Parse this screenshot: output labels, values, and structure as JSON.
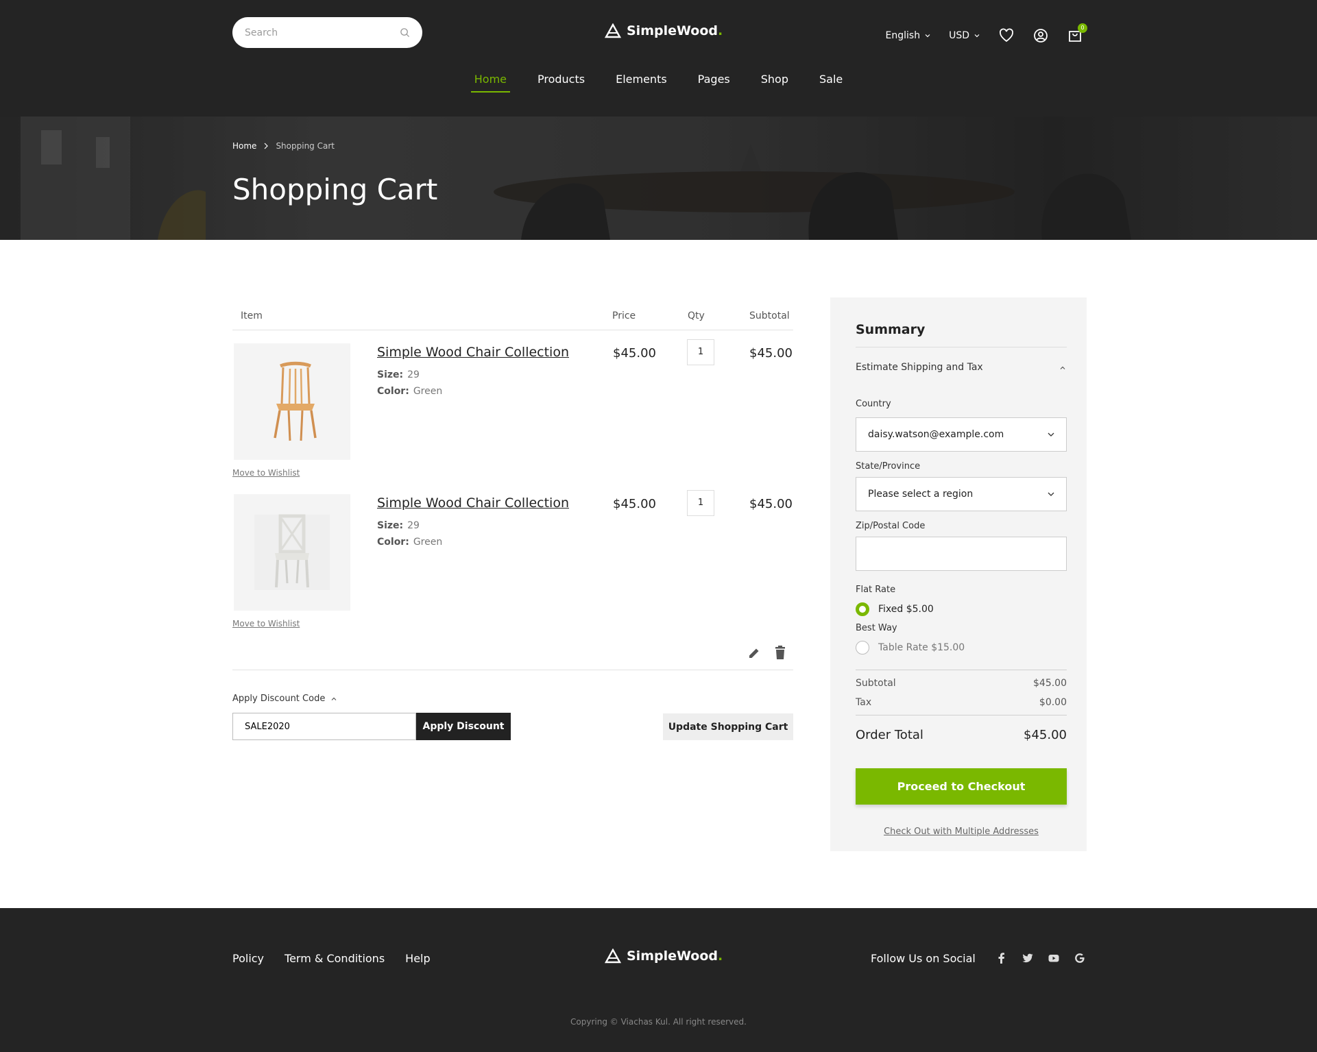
{
  "header": {
    "search_placeholder": "Search",
    "brand": "SimpleWood",
    "brand_dot": ".",
    "language": "English",
    "currency": "USD",
    "cart_count": "0"
  },
  "nav": [
    "Home",
    "Products",
    "Elements",
    "Pages",
    "Shop",
    "Sale"
  ],
  "banner": {
    "crumb_home": "Home",
    "crumb_current": "Shopping Cart",
    "title": "Shopping Cart"
  },
  "table": {
    "col_item": "Item",
    "col_price": "Price",
    "col_qty": "Qty",
    "col_subtotal": "Subtotal"
  },
  "items": [
    {
      "name": "Simple Wood Chair Collection",
      "size_label": "Size:",
      "size": "29",
      "color_label": "Color:",
      "color": "Green",
      "price": "$45.00",
      "qty": "1",
      "subtotal": "$45.00",
      "wishlist": "Move to Wishlist"
    },
    {
      "name": "Simple Wood Chair Collection",
      "size_label": "Size:",
      "size": "29",
      "color_label": "Color:",
      "color": "Green",
      "price": "$45.00",
      "qty": "1",
      "subtotal": "$45.00",
      "wishlist": "Move to Wishlist"
    }
  ],
  "discount": {
    "label": "Apply Discount Code",
    "value": "SALE2020",
    "apply": "Apply Discount",
    "update": "Update Shopping Cart"
  },
  "summary": {
    "title": "Summary",
    "estimate": "Estimate Shipping and Tax",
    "country_label": "Country",
    "country_value": "daisy.watson@example.com",
    "state_label": "State/Province",
    "state_value": "Please select a region",
    "zip_label": "Zip/Postal Code",
    "zip_value": "",
    "flat_label": "Flat Rate",
    "flat_option": "Fixed $5.00",
    "best_label": "Best Way",
    "best_option": "Table Rate $15.00",
    "subtotal_label": "Subtotal",
    "subtotal": "$45.00",
    "tax_label": "Tax",
    "tax": "$0.00",
    "total_label": "Order Total",
    "total": "$45.00",
    "checkout": "Proceed to Checkout",
    "multi": "Check Out with Multiple Addresses"
  },
  "footer": {
    "links": [
      "Policy",
      "Term & Conditions",
      "Help"
    ],
    "brand": "SimpleWood",
    "brand_dot": ".",
    "follow": "Follow Us on Social",
    "copyright": "Copyring © Viachas Kul. All right reserved."
  },
  "colors": {
    "accent": "#7ab800",
    "dark": "#242424"
  },
  "icons": [
    "search-icon",
    "logo-icon",
    "chevron-down-icon",
    "heart-icon",
    "user-icon",
    "cart-icon",
    "chevron-right-icon",
    "chevron-up-icon",
    "edit-icon",
    "trash-icon",
    "facebook-icon",
    "twitter-icon",
    "youtube-icon",
    "google-icon"
  ]
}
